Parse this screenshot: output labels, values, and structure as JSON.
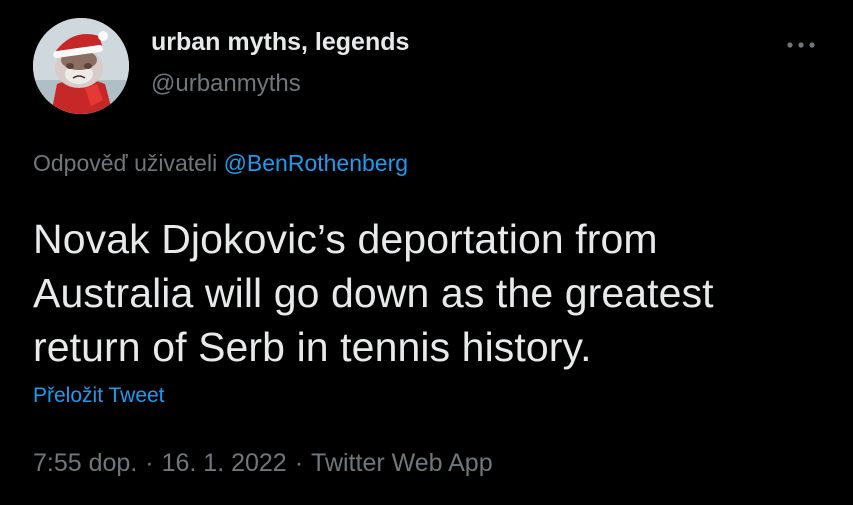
{
  "author": {
    "display_name": "urban myths, legends",
    "handle": "@urbanmyths",
    "avatar": "grumpy-cat-santa-hat-avatar"
  },
  "more_icon": "more-horizontal-icon",
  "reply": {
    "prefix": "Odpověď uživateli",
    "mention": "@BenRothenberg"
  },
  "tweet": {
    "text": "Novak Djokovic’s deportation from Australia will go down as the greatest return of Serb in tennis history."
  },
  "translate_label": "Přeložit Tweet",
  "meta": {
    "time": "7:55 dop.",
    "separator": "·",
    "date": "16. 1. 2022",
    "source": "Twitter Web App"
  },
  "colors": {
    "background": "#000000",
    "text": "#e7e9ea",
    "secondary": "#71767b",
    "accent": "#1d9bf0"
  }
}
